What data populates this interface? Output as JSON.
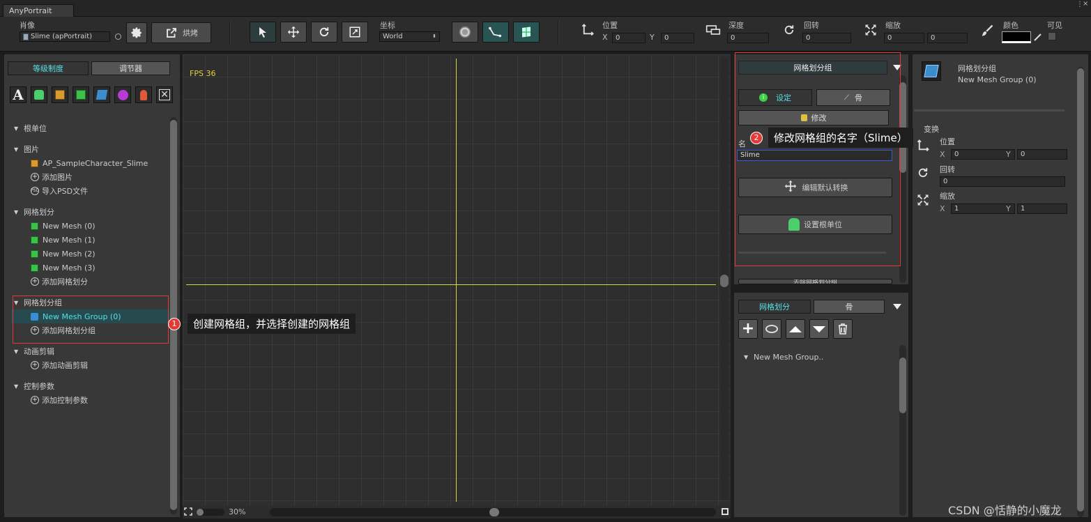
{
  "window": {
    "tab_title": "AnyPortrait",
    "close_glyph": "×",
    "menu_glyph": "⋮"
  },
  "toolbar": {
    "portrait_label": "肖像",
    "portrait_value": "Slime (apPortrait)",
    "bake_label": "烘烤",
    "coord_label": "坐标",
    "coord_value": "World",
    "position_label": "位置",
    "pos_x_label": "X",
    "pos_x": "0",
    "pos_y_label": "Y",
    "pos_y": "0",
    "depth_label": "深度",
    "depth": "0",
    "rotation_label": "回转",
    "rotation": "0",
    "scale_label": "缩放",
    "scale_x": "0",
    "scale_y": "0",
    "color_label": "颜色",
    "visible_label": "可见"
  },
  "left": {
    "tabs": [
      "等级制度",
      "调节器"
    ],
    "tree": {
      "root": "根单位",
      "images": "图片",
      "image_item": "AP_SampleCharacter_Slime",
      "add_image": "添加图片",
      "import_psd": "导入PSD文件",
      "meshes": "网格划分",
      "mesh_items": [
        "New Mesh (0)",
        "New Mesh (1)",
        "New Mesh (2)",
        "New Mesh (3)"
      ],
      "add_mesh": "添加网格划分",
      "mesh_groups": "网格划分组",
      "mesh_group_item": "New Mesh Group (0)",
      "add_mesh_group": "添加网格划分组",
      "anim": "动画剪辑",
      "add_anim": "添加动画剪辑",
      "params": "控制参数",
      "add_param": "添加控制参数"
    }
  },
  "canvas": {
    "fps": "FPS 36",
    "zoom": "30%"
  },
  "inspector": {
    "header": "网格划分组",
    "tab_setting": "设定",
    "tab_bone": "骨",
    "modify": "修改",
    "name_label": "名",
    "name_value": "Slime",
    "edit_default_transform": "编辑默认转换",
    "set_root_unit": "设置根单位",
    "remove_btn": "去除网格划分组"
  },
  "hierarchy2": {
    "tab_mesh": "网格划分",
    "tab_bone": "骨",
    "item": "New Mesh Group.."
  },
  "properties": {
    "name": "网格划分组",
    "sub": "New Mesh Group (0)",
    "transform_label": "变换",
    "pos_label": "位置",
    "x_label": "X",
    "x": "0",
    "y_label": "Y",
    "y": "0",
    "rot_label": "回转",
    "rot": "0",
    "scale_label": "缩放",
    "sx": "1",
    "sy": "1"
  },
  "callouts": {
    "c1_num": "1",
    "c1": "创建网格组，并选择创建的网格组",
    "c2_num": "2",
    "c2": "修改网格组的名字（Slime）"
  },
  "watermark": "CSDN @恬静的小魔龙",
  "colors": {
    "accent": "#55e0e6",
    "selection": "#274a4e",
    "highlight_box": "#e03a3a",
    "badge": "#e53935"
  }
}
